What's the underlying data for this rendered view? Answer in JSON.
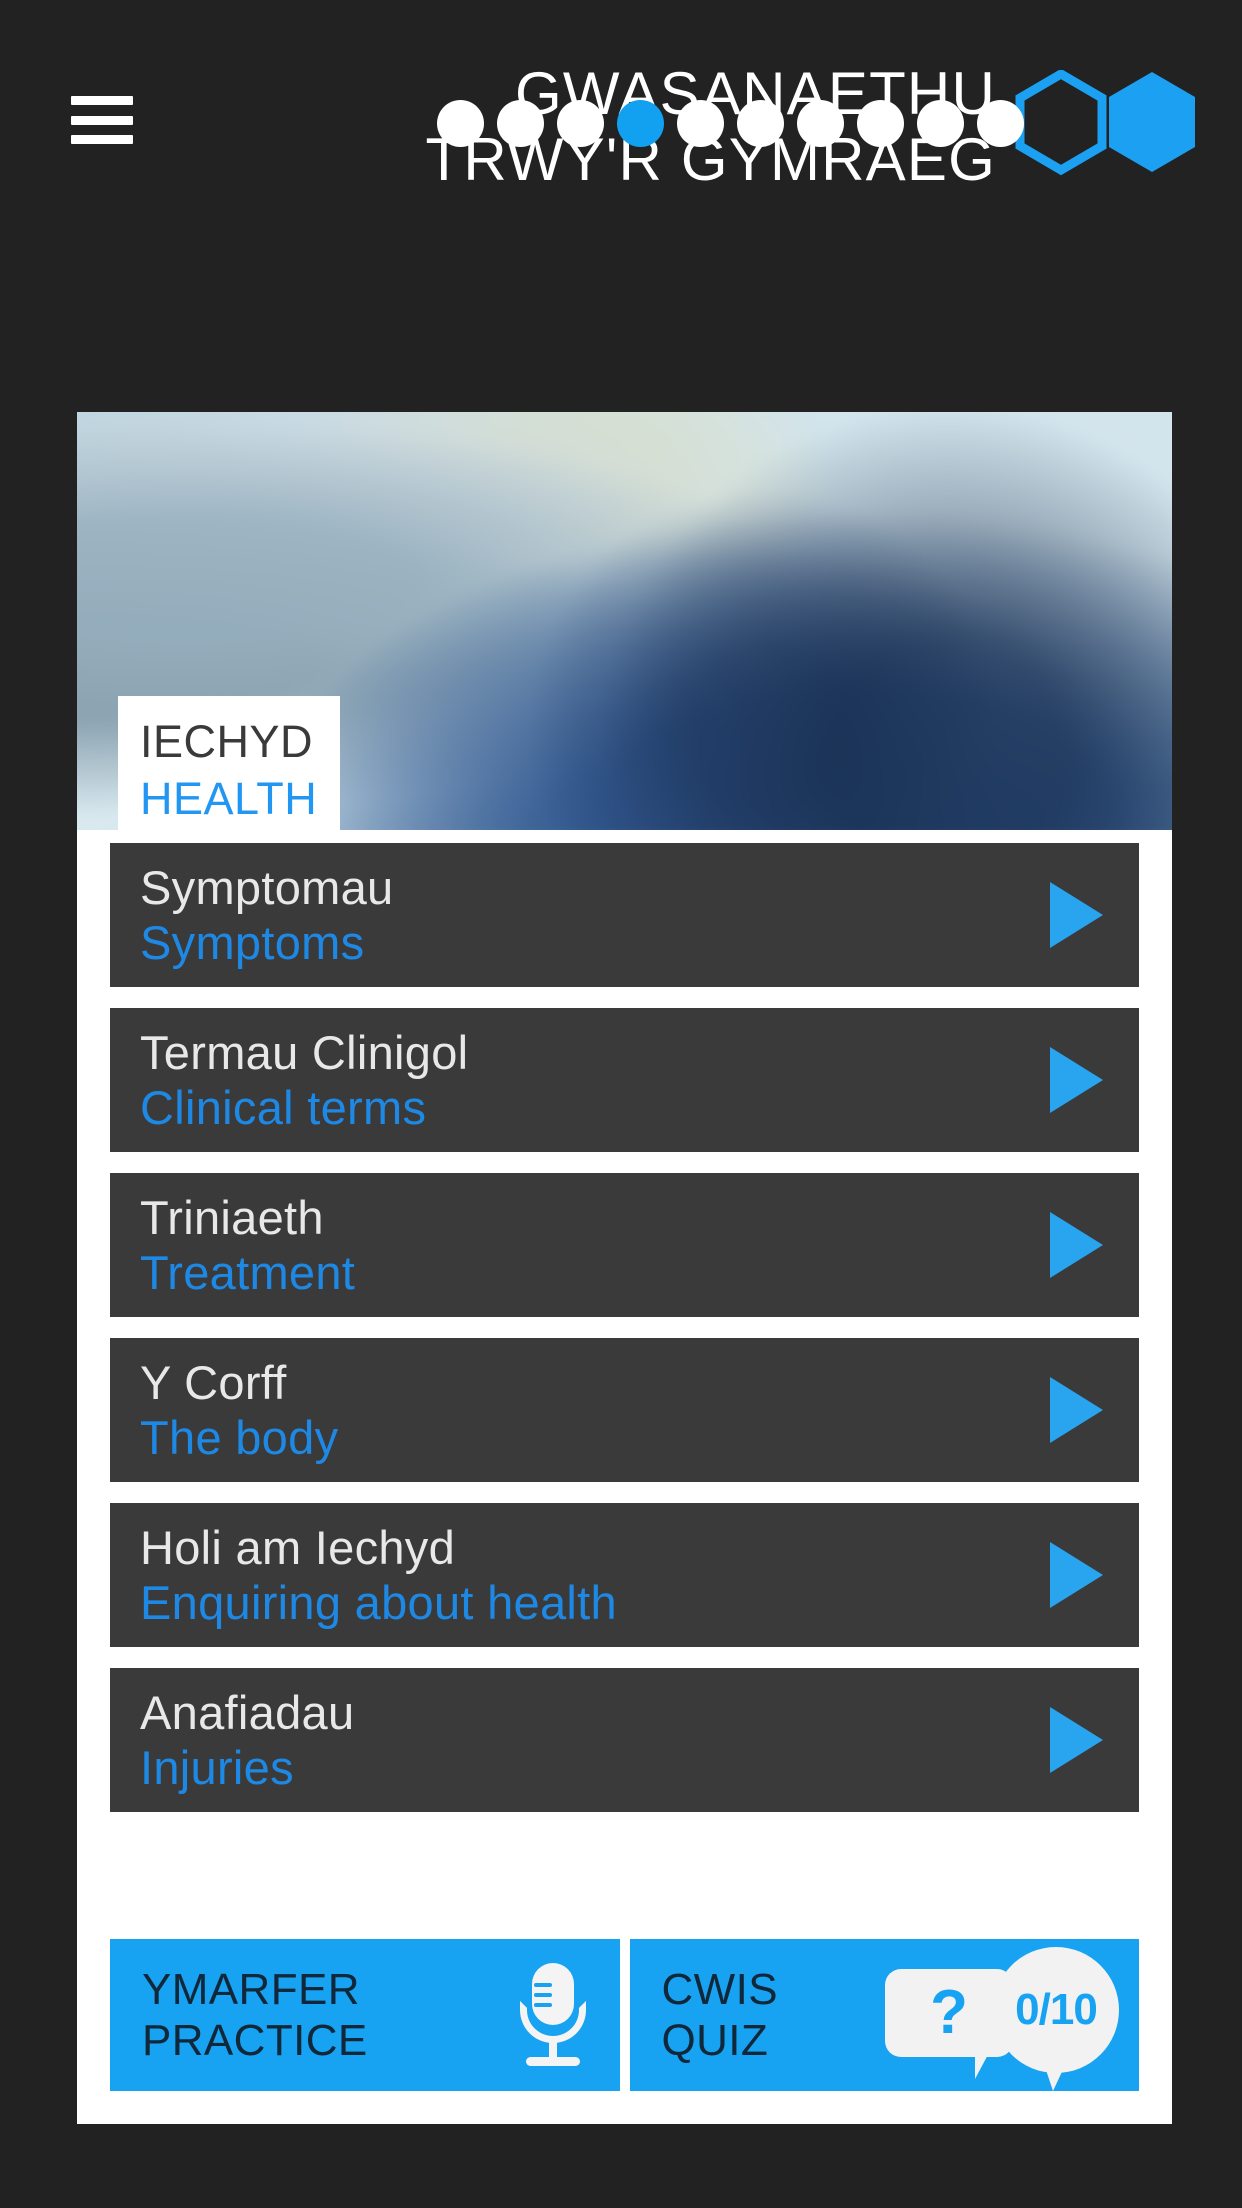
{
  "brand": {
    "line1": "GWASANAETHU",
    "line2": "TRWY'R GYMRAEG",
    "logo_outline_color": "#1BA0F2",
    "logo_fill_color": "#1BA0F2"
  },
  "nav": {
    "menu_icon": "hamburger-menu-icon",
    "pager": {
      "total": 10,
      "active_index": 4,
      "active_color": "#12A0F0",
      "inactive_color": "#FFFFFF"
    }
  },
  "hero": {
    "title_cy": "IECHYD",
    "title_en": "HEALTH",
    "title_cy_color": "#3A3A3A",
    "title_en_color": "#2196F3",
    "image_alt": "hospital-ward-photo"
  },
  "topics": [
    {
      "cy": "Symptomau",
      "en": "Symptoms"
    },
    {
      "cy": "Termau Clinigol",
      "en": "Clinical terms"
    },
    {
      "cy": "Triniaeth",
      "en": "Treatment"
    },
    {
      "cy": "Y Corff",
      "en": "The body"
    },
    {
      "cy": "Holi am Iechyd",
      "en": "Enquiring about health"
    },
    {
      "cy": "Anafiadau",
      "en": "Injuries"
    }
  ],
  "actions": {
    "practice": {
      "cy": "YMARFER",
      "en": "PRACTICE",
      "icon": "microphone-icon"
    },
    "quiz": {
      "cy": "CWIS",
      "en": "QUIZ",
      "icon": "question-bubble-icon",
      "score": "0/10"
    },
    "button_color": "#17A3F2",
    "label_color": "#11273A"
  },
  "theme": {
    "background": "#222222",
    "panel": "#FFFFFF",
    "row": "#3A3A3A",
    "accent_blue": "#1E88E5",
    "play_blue": "#29A4EE"
  }
}
